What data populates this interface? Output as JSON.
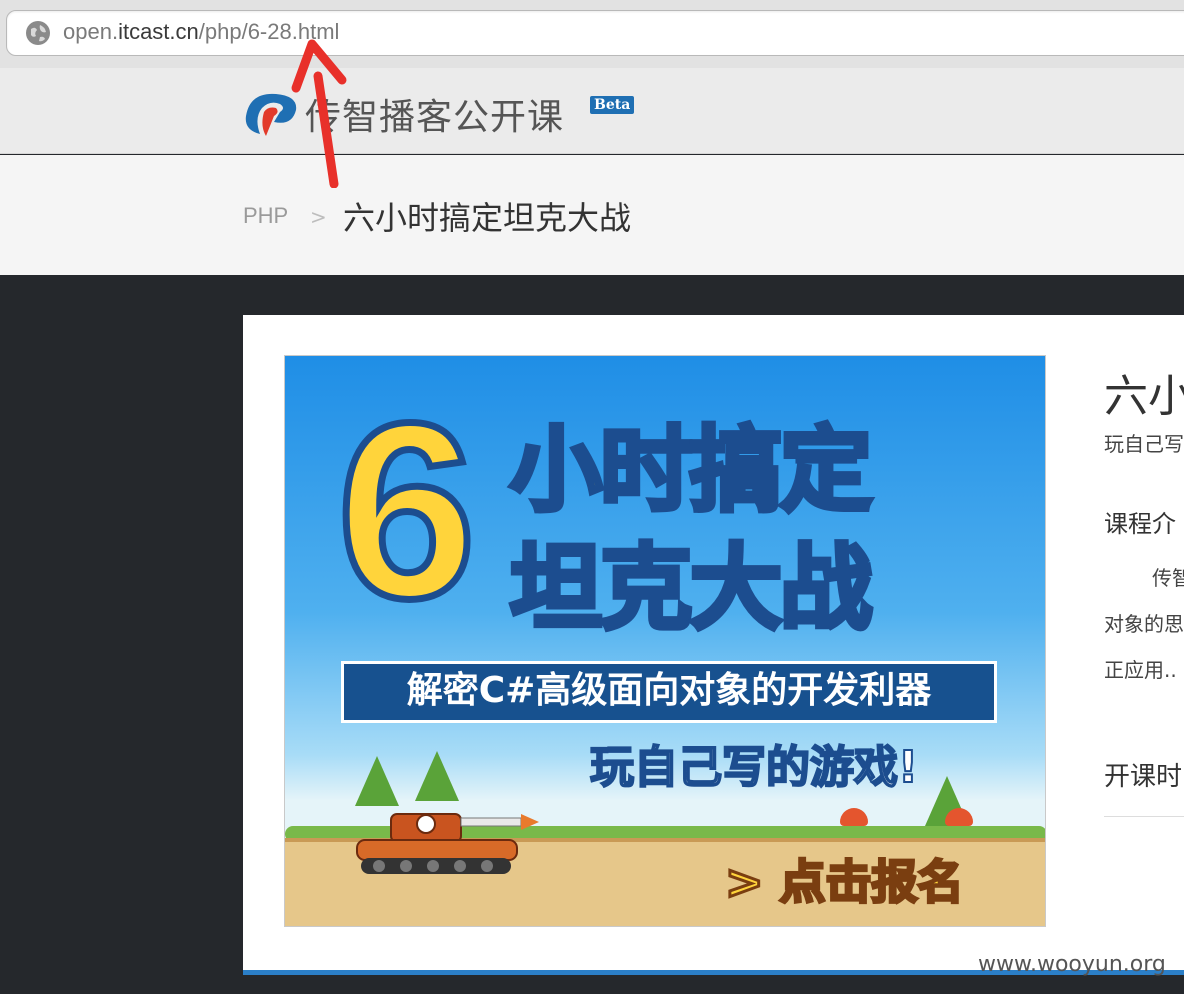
{
  "browser": {
    "url_prefix": "open.",
    "url_domain": "itcast.cn",
    "url_path": "/php/6-28.html"
  },
  "header": {
    "site_name": "传智播客公开课",
    "badge": "Beta"
  },
  "breadcrumb": {
    "parent": "PHP",
    "separator": ">",
    "current": "六小时搞定坦克大战"
  },
  "banner": {
    "big_number": "6",
    "title_line1": "小时搞定",
    "title_line2": "坦克大战",
    "strip_text": "解密C#高级面向对象的开发利器",
    "play_text": "玩自己写的游戏!",
    "cta_text": "> 点击报名"
  },
  "course_info": {
    "title": "六小",
    "subtitle": "玩自己写",
    "intro_heading": "课程介",
    "para1": "传智",
    "para2": "对象的思",
    "para3": "正应用..",
    "schedule_heading": "开课时"
  },
  "watermark": "www.wooyun.org",
  "colors": {
    "accent_blue": "#2b7fc8",
    "annotation_red": "#e8302a",
    "banner_yellow": "#ffd43b"
  }
}
